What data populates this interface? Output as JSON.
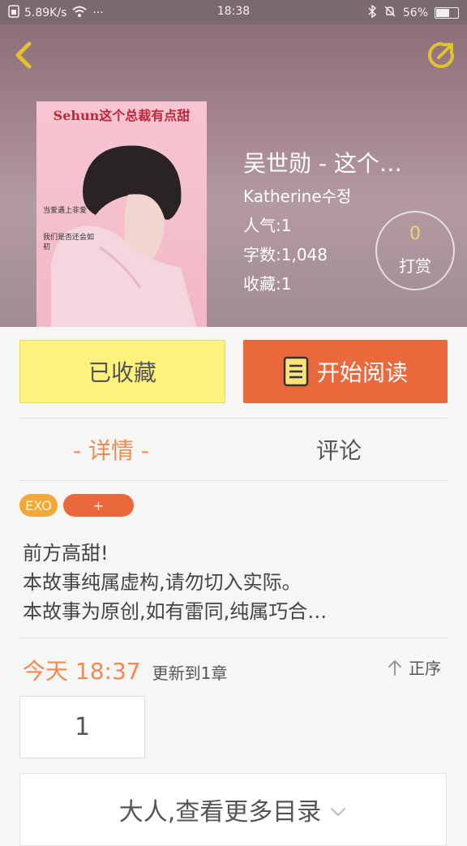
{
  "status_bar": {
    "speed": "5.89K/s",
    "dots": "···",
    "time": "18:38",
    "battery": "56%"
  },
  "book": {
    "cover_title": "Sehun这个总裁有点甜",
    "cover_text_1": "当爱遇上非爱",
    "cover_text_2": "我们是否还会如初",
    "title": "吴世勋 - 这个…",
    "author": "Katherine수정",
    "popularity": "人气:1",
    "word_count": "字数:1,048",
    "favorites": "收藏:1",
    "tip_count": "0",
    "tip_label": "打赏"
  },
  "actions": {
    "collected_label": "已收藏",
    "start_reading_label": "开始阅读"
  },
  "tabs": {
    "detail": "- 详情 -",
    "comment": "评论"
  },
  "tags": [
    "EXO",
    "+"
  ],
  "description": [
    "前方高甜!",
    "本故事纯属虚构,请勿切入实际。",
    "本故事为原创,如有雷同,纯属巧合…"
  ],
  "update": {
    "today": "今天 18:37",
    "text": "更新到1章"
  },
  "order_label": "正序",
  "chapters": [
    "1"
  ],
  "more_label": "大人,查看更多目录"
}
